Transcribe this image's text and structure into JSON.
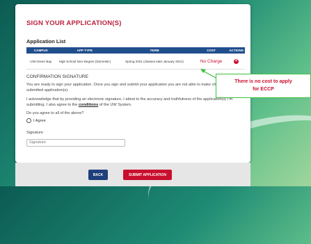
{
  "header": {
    "title": "SIGN YOUR APPLICATION(S)"
  },
  "application_list": {
    "heading": "Application List",
    "columns": [
      "CAMPUS",
      "APP TYPE",
      "TERM",
      "COST",
      "ACTIONS"
    ],
    "rows": [
      {
        "campus": "UW-Green Bay",
        "app_type": "High School Non-Degree (Domestic)",
        "term": "Spring 2021 (classes start January 2021)",
        "cost": "No Charge"
      }
    ]
  },
  "confirmation": {
    "heading": "CONFIRMATION SIGNATURE",
    "text1": "You are ready to sign your application. Once you sign and submit your application you are not able to make changes to your submitted application(s).",
    "text2_prefix": "I acknowledge that by providing an electronic signature, I attest to the accuracy and truthfulness of the application(s) I'm submitting. I also agree to the ",
    "text2_link": "conditions",
    "text2_suffix": " of the UW System.",
    "question": "Do you agree to all of the above?",
    "agree_label": "I Agree",
    "signature_label": "Signature",
    "signature_placeholder": "Signature"
  },
  "buttons": {
    "back": "BACK",
    "submit": "SUBMIT APPLICATION"
  },
  "callout": {
    "line1": "There is no cost to apply",
    "line2": "for ECCP"
  },
  "colors": {
    "title": "#b8213b",
    "table_header": "#1f4e8c",
    "cost": "#c8102e",
    "callout_border": "#3fbf3f"
  }
}
